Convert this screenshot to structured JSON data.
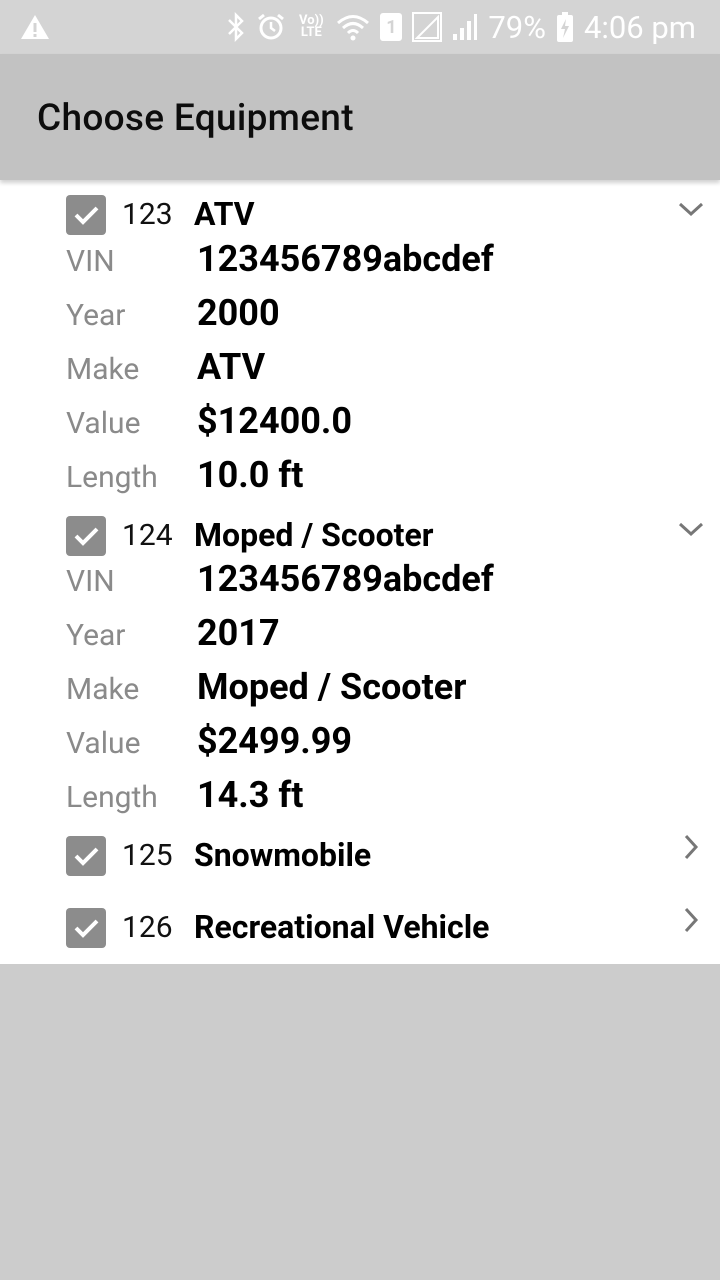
{
  "status_bar": {
    "battery": "79%",
    "time": "4:06 pm",
    "network_label": "Vo)) LTE",
    "sim_slot": "1"
  },
  "toolbar": {
    "title": "Choose Equipment"
  },
  "items": [
    {
      "number": "123",
      "name": "ATV",
      "checked": true,
      "expanded": true,
      "details": {
        "vin_label": "VIN",
        "vin": "123456789abcdef",
        "year_label": "Year",
        "year": "2000",
        "make_label": "Make",
        "make": "ATV",
        "value_label": "Value",
        "value": "$12400.0",
        "length_label": "Length",
        "length": "10.0 ft"
      }
    },
    {
      "number": "124",
      "name": "Moped / Scooter",
      "checked": true,
      "expanded": true,
      "details": {
        "vin_label": "VIN",
        "vin": "123456789abcdef",
        "year_label": "Year",
        "year": "2017",
        "make_label": "Make",
        "make": "Moped / Scooter",
        "value_label": "Value",
        "value": "$2499.99",
        "length_label": "Length",
        "length": "14.3 ft"
      }
    },
    {
      "number": "125",
      "name": "Snowmobile",
      "checked": true,
      "expanded": false
    },
    {
      "number": "126",
      "name": "Recreational Vehicle",
      "checked": true,
      "expanded": false
    }
  ]
}
